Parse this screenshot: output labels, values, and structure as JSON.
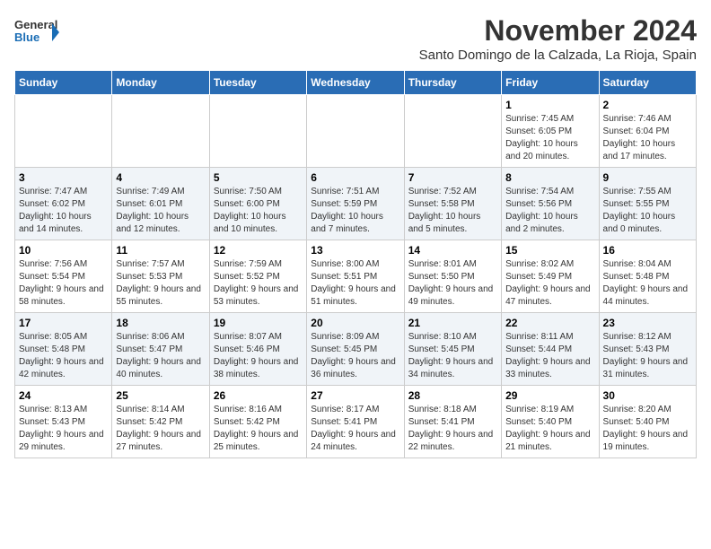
{
  "logo": {
    "line1": "General",
    "line2": "Blue"
  },
  "title": "November 2024",
  "subtitle": "Santo Domingo de la Calzada, La Rioja, Spain",
  "days_of_week": [
    "Sunday",
    "Monday",
    "Tuesday",
    "Wednesday",
    "Thursday",
    "Friday",
    "Saturday"
  ],
  "weeks": [
    [
      {
        "day": "",
        "info": ""
      },
      {
        "day": "",
        "info": ""
      },
      {
        "day": "",
        "info": ""
      },
      {
        "day": "",
        "info": ""
      },
      {
        "day": "",
        "info": ""
      },
      {
        "day": "1",
        "info": "Sunrise: 7:45 AM\nSunset: 6:05 PM\nDaylight: 10 hours and 20 minutes."
      },
      {
        "day": "2",
        "info": "Sunrise: 7:46 AM\nSunset: 6:04 PM\nDaylight: 10 hours and 17 minutes."
      }
    ],
    [
      {
        "day": "3",
        "info": "Sunrise: 7:47 AM\nSunset: 6:02 PM\nDaylight: 10 hours and 14 minutes."
      },
      {
        "day": "4",
        "info": "Sunrise: 7:49 AM\nSunset: 6:01 PM\nDaylight: 10 hours and 12 minutes."
      },
      {
        "day": "5",
        "info": "Sunrise: 7:50 AM\nSunset: 6:00 PM\nDaylight: 10 hours and 10 minutes."
      },
      {
        "day": "6",
        "info": "Sunrise: 7:51 AM\nSunset: 5:59 PM\nDaylight: 10 hours and 7 minutes."
      },
      {
        "day": "7",
        "info": "Sunrise: 7:52 AM\nSunset: 5:58 PM\nDaylight: 10 hours and 5 minutes."
      },
      {
        "day": "8",
        "info": "Sunrise: 7:54 AM\nSunset: 5:56 PM\nDaylight: 10 hours and 2 minutes."
      },
      {
        "day": "9",
        "info": "Sunrise: 7:55 AM\nSunset: 5:55 PM\nDaylight: 10 hours and 0 minutes."
      }
    ],
    [
      {
        "day": "10",
        "info": "Sunrise: 7:56 AM\nSunset: 5:54 PM\nDaylight: 9 hours and 58 minutes."
      },
      {
        "day": "11",
        "info": "Sunrise: 7:57 AM\nSunset: 5:53 PM\nDaylight: 9 hours and 55 minutes."
      },
      {
        "day": "12",
        "info": "Sunrise: 7:59 AM\nSunset: 5:52 PM\nDaylight: 9 hours and 53 minutes."
      },
      {
        "day": "13",
        "info": "Sunrise: 8:00 AM\nSunset: 5:51 PM\nDaylight: 9 hours and 51 minutes."
      },
      {
        "day": "14",
        "info": "Sunrise: 8:01 AM\nSunset: 5:50 PM\nDaylight: 9 hours and 49 minutes."
      },
      {
        "day": "15",
        "info": "Sunrise: 8:02 AM\nSunset: 5:49 PM\nDaylight: 9 hours and 47 minutes."
      },
      {
        "day": "16",
        "info": "Sunrise: 8:04 AM\nSunset: 5:48 PM\nDaylight: 9 hours and 44 minutes."
      }
    ],
    [
      {
        "day": "17",
        "info": "Sunrise: 8:05 AM\nSunset: 5:48 PM\nDaylight: 9 hours and 42 minutes."
      },
      {
        "day": "18",
        "info": "Sunrise: 8:06 AM\nSunset: 5:47 PM\nDaylight: 9 hours and 40 minutes."
      },
      {
        "day": "19",
        "info": "Sunrise: 8:07 AM\nSunset: 5:46 PM\nDaylight: 9 hours and 38 minutes."
      },
      {
        "day": "20",
        "info": "Sunrise: 8:09 AM\nSunset: 5:45 PM\nDaylight: 9 hours and 36 minutes."
      },
      {
        "day": "21",
        "info": "Sunrise: 8:10 AM\nSunset: 5:45 PM\nDaylight: 9 hours and 34 minutes."
      },
      {
        "day": "22",
        "info": "Sunrise: 8:11 AM\nSunset: 5:44 PM\nDaylight: 9 hours and 33 minutes."
      },
      {
        "day": "23",
        "info": "Sunrise: 8:12 AM\nSunset: 5:43 PM\nDaylight: 9 hours and 31 minutes."
      }
    ],
    [
      {
        "day": "24",
        "info": "Sunrise: 8:13 AM\nSunset: 5:43 PM\nDaylight: 9 hours and 29 minutes."
      },
      {
        "day": "25",
        "info": "Sunrise: 8:14 AM\nSunset: 5:42 PM\nDaylight: 9 hours and 27 minutes."
      },
      {
        "day": "26",
        "info": "Sunrise: 8:16 AM\nSunset: 5:42 PM\nDaylight: 9 hours and 25 minutes."
      },
      {
        "day": "27",
        "info": "Sunrise: 8:17 AM\nSunset: 5:41 PM\nDaylight: 9 hours and 24 minutes."
      },
      {
        "day": "28",
        "info": "Sunrise: 8:18 AM\nSunset: 5:41 PM\nDaylight: 9 hours and 22 minutes."
      },
      {
        "day": "29",
        "info": "Sunrise: 8:19 AM\nSunset: 5:40 PM\nDaylight: 9 hours and 21 minutes."
      },
      {
        "day": "30",
        "info": "Sunrise: 8:20 AM\nSunset: 5:40 PM\nDaylight: 9 hours and 19 minutes."
      }
    ]
  ]
}
